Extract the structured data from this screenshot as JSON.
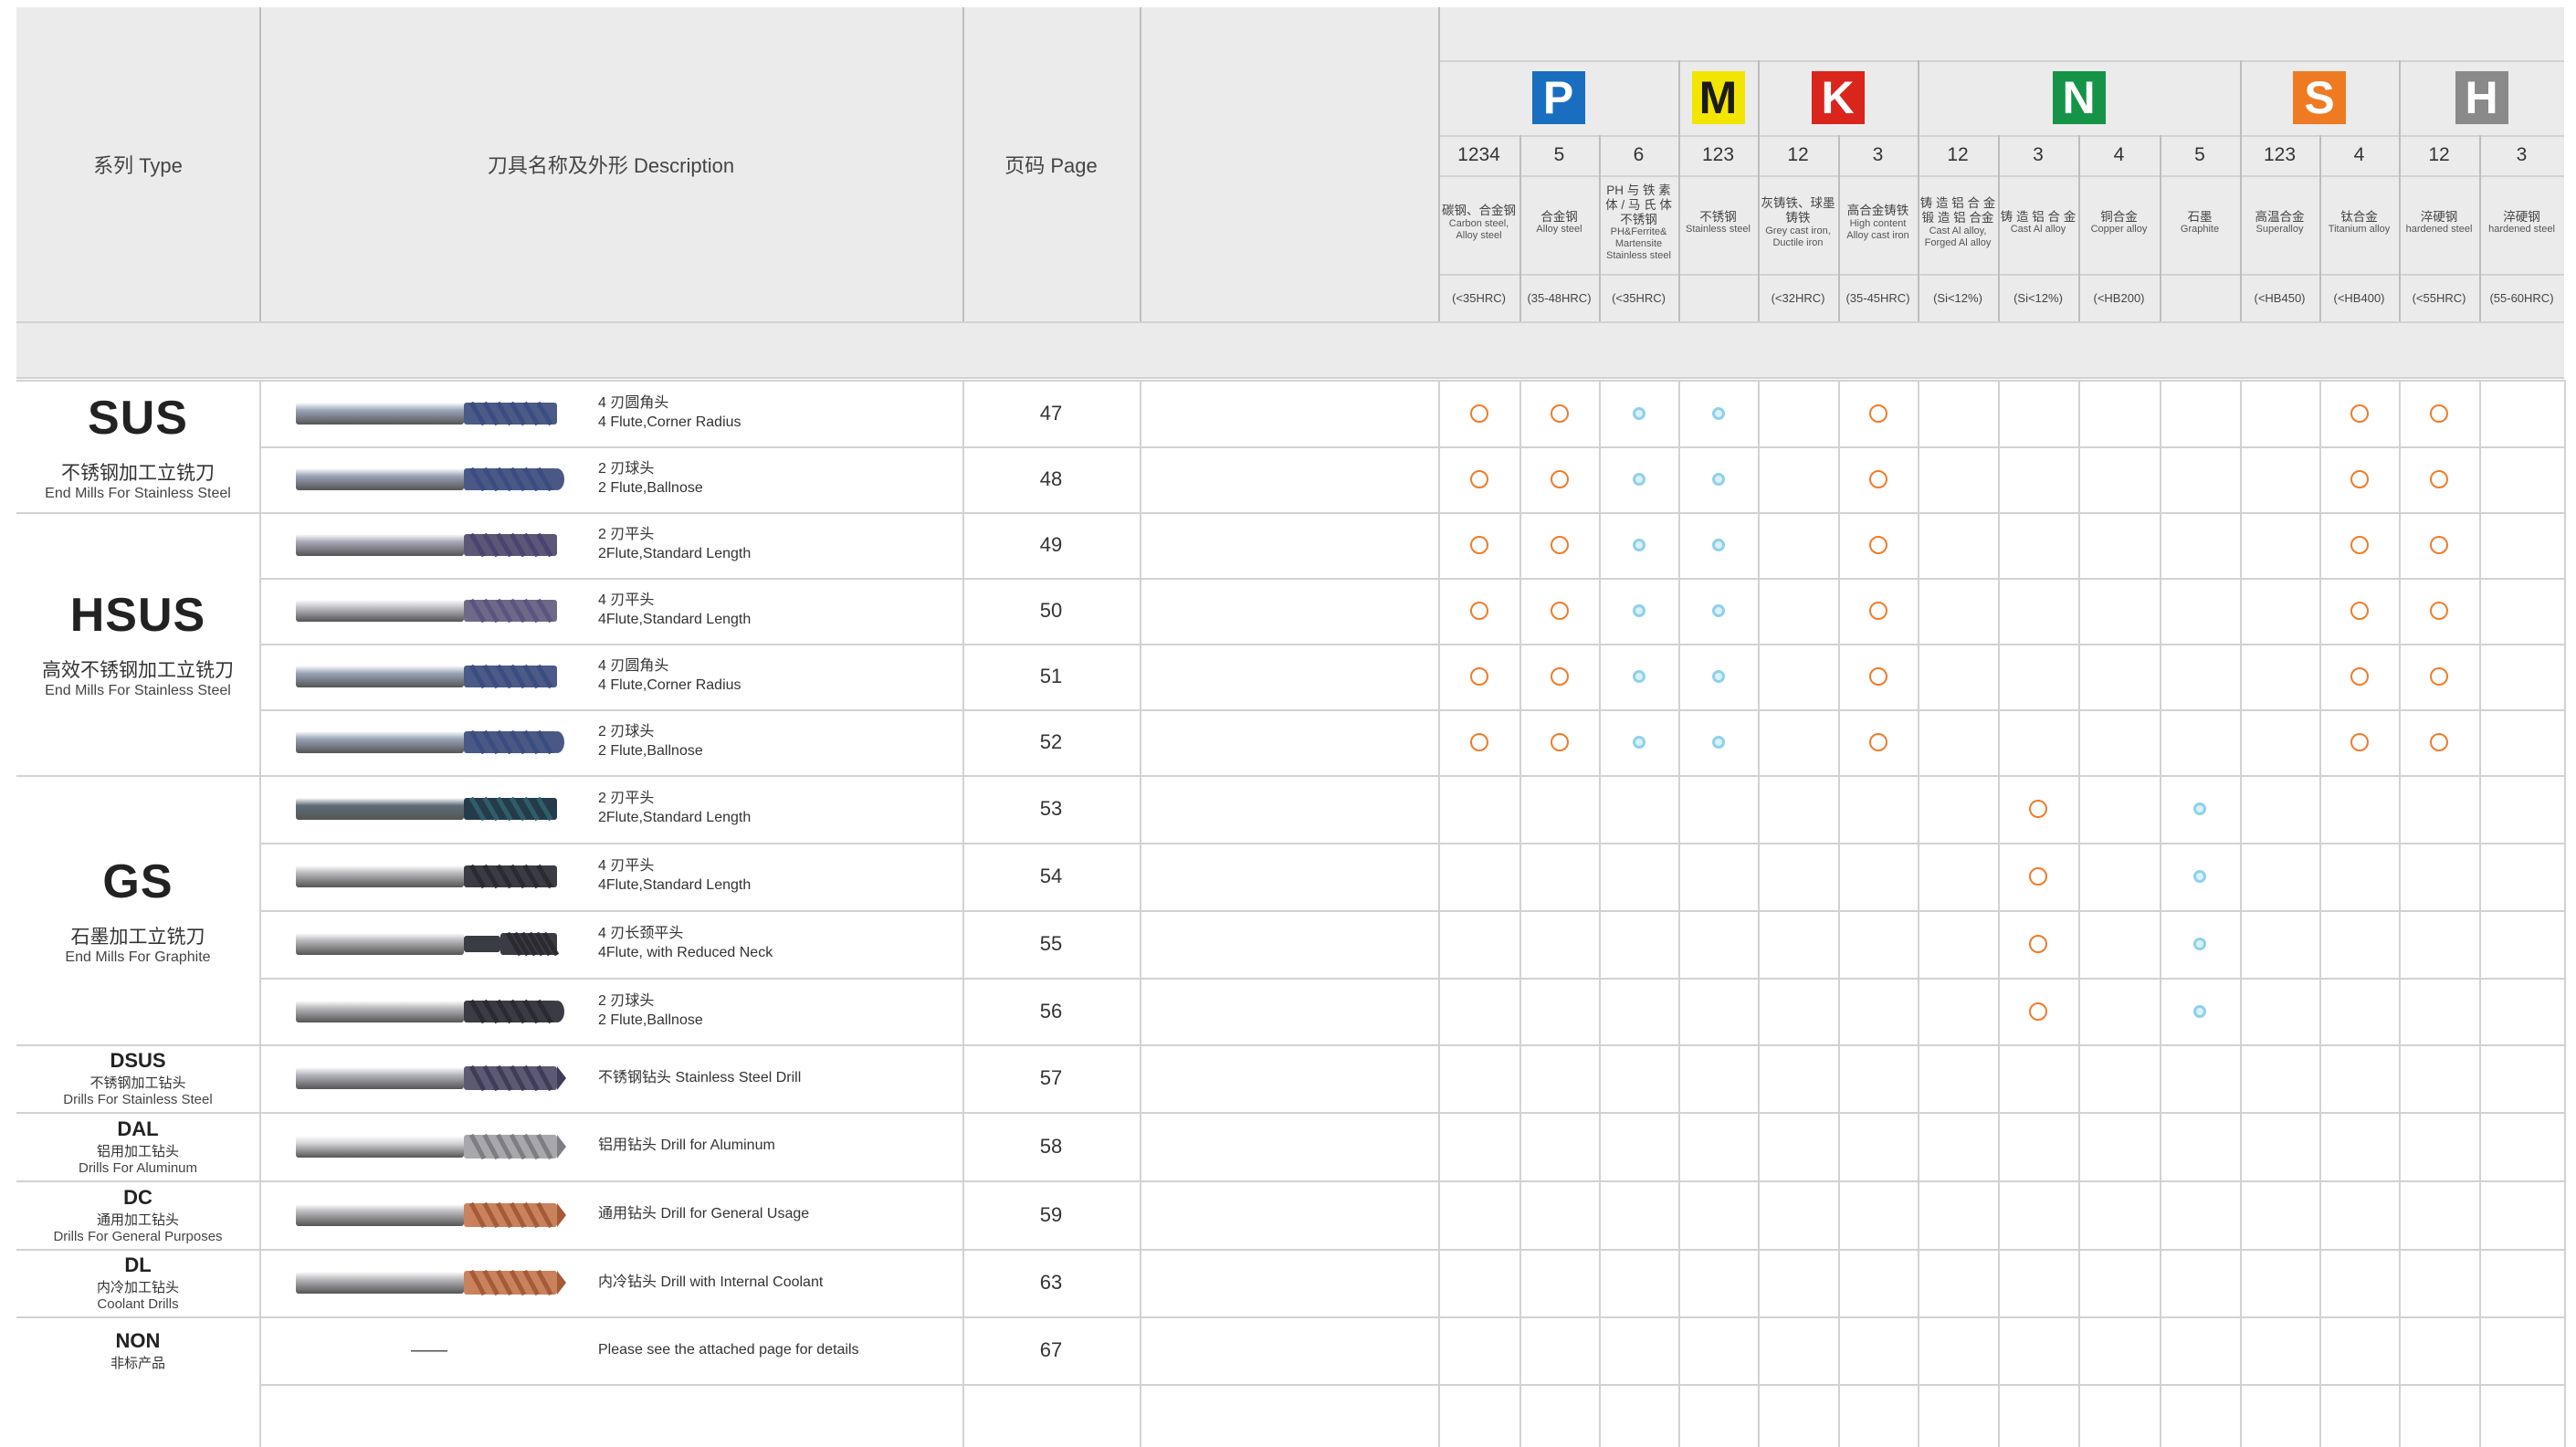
{
  "header": {
    "type_label": "系列 Type",
    "desc_label": "刀具名称及外形 Description",
    "page_label": "页码 Page",
    "iso_groups": [
      {
        "letter": "P",
        "color": "#1a6ec0"
      },
      {
        "letter": "M",
        "color": "#f2e600"
      },
      {
        "letter": "K",
        "color": "#d9251c"
      },
      {
        "letter": "N",
        "color": "#159447"
      },
      {
        "letter": "S",
        "color": "#ee7b22"
      },
      {
        "letter": "H",
        "color": "#8a8a8a"
      }
    ],
    "columns": [
      {
        "num": "1234",
        "cn": "碳钢、合金钢",
        "en": "Carbon steel, Alloy steel",
        "hrc": "(<35HRC)"
      },
      {
        "num": "5",
        "cn": "合金钢",
        "en": "Alloy steel",
        "hrc": "(35-48HRC)"
      },
      {
        "num": "6",
        "cn": "PH 与 铁 素 体 / 马 氏 体 不锈钢",
        "en": "PH&Ferrite& Martensite Stainless steel",
        "hrc": "(<35HRC)"
      },
      {
        "num": "123",
        "cn": "不锈钢",
        "en": "Stainless steel",
        "hrc": ""
      },
      {
        "num": "12",
        "cn": "灰铸铁、球墨铸铁",
        "en": "Grey cast iron, Ductile iron",
        "hrc": "(<32HRC)"
      },
      {
        "num": "3",
        "cn": "高合金铸铁",
        "en": "High content Alloy cast iron",
        "hrc": "(35-45HRC)"
      },
      {
        "num": "12",
        "cn": "铸 造 铝 合 金 锻 造 铝 合金",
        "en": "Cast Al alloy, Forged Al alloy",
        "hrc": "(Si<12%)"
      },
      {
        "num": "3",
        "cn": "铸 造 铝 合 金",
        "en": "Cast Al alloy",
        "hrc": "(Si<12%)"
      },
      {
        "num": "4",
        "cn": "铜合金",
        "en": "Copper alloy",
        "hrc": "(<HB200)"
      },
      {
        "num": "5",
        "cn": "石墨",
        "en": "Graphite",
        "hrc": ""
      },
      {
        "num": "123",
        "cn": "高温合金",
        "en": "Superalloy",
        "hrc": "(<HB450)"
      },
      {
        "num": "4",
        "cn": "钛合金",
        "en": "Titanium alloy",
        "hrc": "(<HB400)"
      },
      {
        "num": "12",
        "cn": "淬硬钢",
        "en": "hardened steel",
        "hrc": "(<55HRC)"
      },
      {
        "num": "3",
        "cn": "淬硬钢",
        "en": "hardened steel",
        "hrc": "(55-60HRC)"
      }
    ]
  },
  "series": [
    {
      "name": "SUS",
      "cn": "不锈钢加工立铣刀",
      "en": "End Mills For Stainless Steel",
      "size": "big"
    },
    {
      "name": "HSUS",
      "cn": "高效不锈钢加工立铣刀",
      "en": "End Mills For Stainless Steel",
      "size": "big"
    },
    {
      "name": "GS",
      "cn": "石墨加工立铣刀",
      "en": "End Mills For Graphite",
      "size": "big"
    },
    {
      "name": "DSUS",
      "cn": "不锈钢加工钻头",
      "en": "Drills For Stainless Steel",
      "size": "small"
    },
    {
      "name": "DAL",
      "cn": "铝用加工钻头",
      "en": "Drills For Aluminum",
      "size": "small"
    },
    {
      "name": "DC",
      "cn": "通用加工钻头",
      "en": "Drills For General Purposes",
      "size": "small"
    },
    {
      "name": "DL",
      "cn": "内冷加工钻头",
      "en": "Coolant Drills",
      "size": "small"
    },
    {
      "name": "NON",
      "cn": "非标产品",
      "en": "",
      "size": "small"
    }
  ],
  "rows": [
    {
      "cn": "4 刃圆角头",
      "en": "4 Flute,Corner Radius",
      "page": "47",
      "tool": "endmill-blue",
      "marks": "oodd o     oo  "
    },
    {
      "cn": "2 刃球头",
      "en": "2 Flute,Ballnose",
      "page": "48",
      "tool": "ball-blue",
      "marks": "oodd o     oo  "
    },
    {
      "cn": "2 刃平头",
      "en": "2Flute,Standard Length",
      "page": "49",
      "tool": "endmill-purple",
      "marks": "oodd o     oo  "
    },
    {
      "cn": "4 刃平头",
      "en": "4Flute,Standard Length",
      "page": "50",
      "tool": "endmill-purple-wide",
      "marks": "oodd o     oo  "
    },
    {
      "cn": "4 刃圆角头",
      "en": "4 Flute,Corner Radius",
      "page": "51",
      "tool": "endmill-blue",
      "marks": "oodd o     oo  "
    },
    {
      "cn": "2 刃球头",
      "en": "2 Flute,Ballnose",
      "page": "52",
      "tool": "ball-blue",
      "marks": "oodd o     oo  "
    },
    {
      "cn": "2 刃平头",
      "en": "2Flute,Standard Length",
      "page": "53",
      "tool": "endmill-teal",
      "marks": "       o d     "
    },
    {
      "cn": "4 刃平头",
      "en": "4Flute,Standard Length",
      "page": "54",
      "tool": "endmill-dark",
      "marks": "       o d     "
    },
    {
      "cn": "4 刃长颈平头",
      "en": "4Flute, with Reduced Neck",
      "page": "55",
      "tool": "endmill-dark-neck",
      "marks": "       o d     "
    },
    {
      "cn": "2 刃球头",
      "en": "2 Flute,Ballnose",
      "page": "56",
      "tool": "ball-dark",
      "marks": "       o d     "
    },
    {
      "cn": "",
      "en": "不锈钢钻头 Stainless Steel Drill",
      "page": "57",
      "tool": "drill-purple",
      "marks": "              "
    },
    {
      "cn": "",
      "en": "铝用钻头 Drill for Aluminum",
      "page": "58",
      "tool": "drill-silver",
      "marks": "              "
    },
    {
      "cn": "",
      "en": "通用钻头 Drill for General Usage",
      "page": "59",
      "tool": "drill-copper",
      "marks": "              "
    },
    {
      "cn": "",
      "en": "内冷钻头 Drill with Internal Coolant",
      "page": "63",
      "tool": "drill-copper",
      "marks": "              "
    },
    {
      "cn": "",
      "en": "Please see the attached page for details",
      "page": "67",
      "tool": "none",
      "marks": "              "
    }
  ],
  "non_tool_dash": "——"
}
